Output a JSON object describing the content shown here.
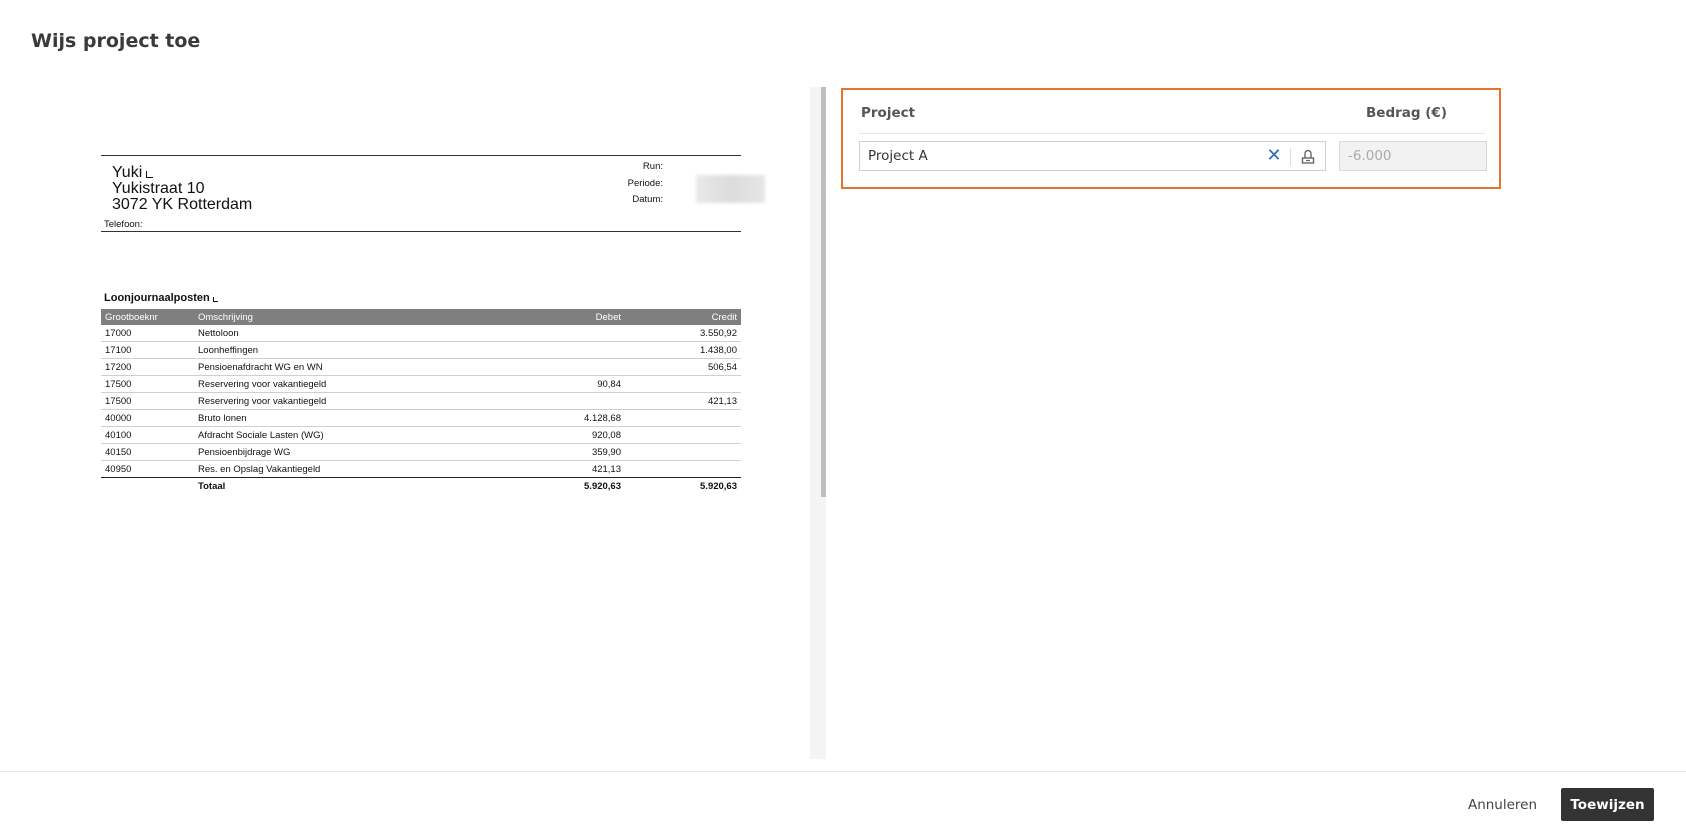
{
  "dialog": {
    "title": "Wijs project toe"
  },
  "document": {
    "address": {
      "name": "Yuki",
      "street": "Yukistraat 10",
      "city": "3072 YK Rotterdam"
    },
    "phone_label": "Telefoon:",
    "meta_labels": {
      "run": "Run:",
      "periode": "Periode:",
      "datum": "Datum:"
    },
    "journal_title": "Loonjournaalposten",
    "columns": [
      "Grootboeknr",
      "Omschrijving",
      "Debet",
      "Credit"
    ],
    "rows": [
      {
        "account": "17000",
        "description": "Nettoloon",
        "debit": "",
        "credit": "3.550,92"
      },
      {
        "account": "17100",
        "description": "Loonheffingen",
        "debit": "",
        "credit": "1.438,00"
      },
      {
        "account": "17200",
        "description": "Pensioenafdracht WG en WN",
        "debit": "",
        "credit": "506,54"
      },
      {
        "account": "17500",
        "description": "Reservering voor vakantiegeld",
        "debit": "90,84",
        "credit": ""
      },
      {
        "account": "17500",
        "description": "Reservering voor vakantiegeld",
        "debit": "",
        "credit": "421,13"
      },
      {
        "account": "40000",
        "description": "Bruto lonen",
        "debit": "4.128,68",
        "credit": ""
      },
      {
        "account": "40100",
        "description": "Afdracht Sociale Lasten (WG)",
        "debit": "920,08",
        "credit": ""
      },
      {
        "account": "40150",
        "description": "Pensioenbijdrage WG",
        "debit": "359,90",
        "credit": ""
      },
      {
        "account": "40950",
        "description": "Res. en Opslag Vakantiegeld",
        "debit": "421,13",
        "credit": ""
      }
    ],
    "total": {
      "label": "Totaal",
      "debit": "5.920,63",
      "credit": "5.920,63"
    }
  },
  "assignment": {
    "project_header": "Project",
    "amount_header": "Bedrag (€)",
    "project_value": "Project A",
    "amount_value": "-6.000",
    "clear_icon": "close-icon",
    "lookup_icon": "lookup-icon",
    "highlight_color": "#e6722f"
  },
  "footer": {
    "cancel_label": "Annuleren",
    "assign_label": "Toewijzen"
  }
}
